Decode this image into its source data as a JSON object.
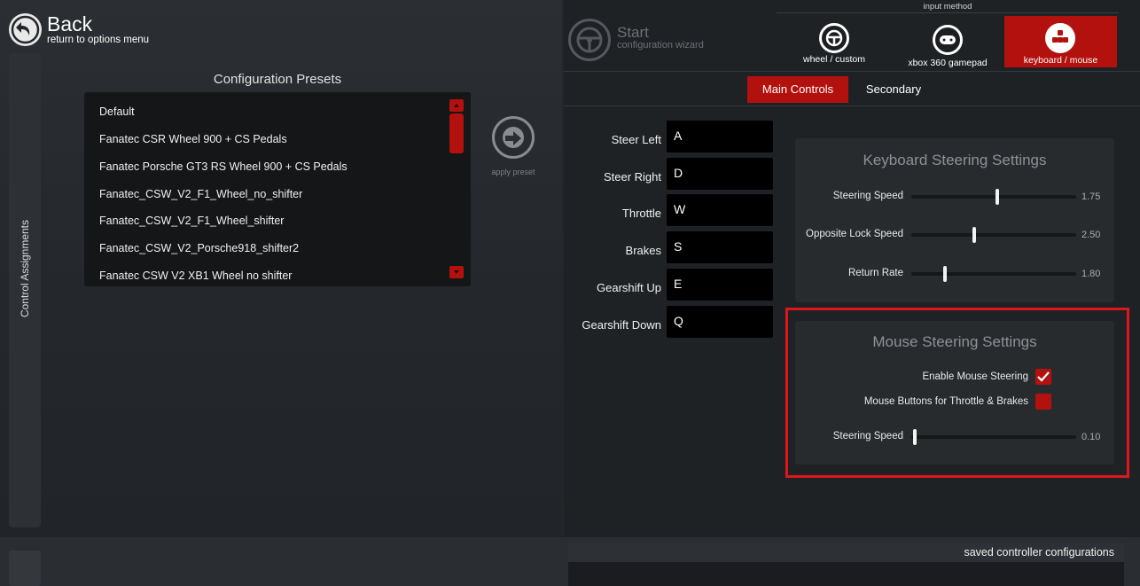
{
  "header": {
    "back_title": "Back",
    "back_subtitle": "return to options menu",
    "back_icon": "arrow-left-circle-icon"
  },
  "sidebar": {
    "label": "Control Assignments"
  },
  "presets": {
    "title": "Configuration Presets",
    "items": [
      "Default",
      "Fanatec CSR Wheel 900 + CS Pedals",
      "Fanatec Porsche GT3 RS Wheel 900 + CS Pedals",
      "Fanatec_CSW_V2_F1_Wheel_no_shifter",
      "Fanatec_CSW_V2_F1_Wheel_shifter",
      "Fanatec_CSW_V2_Porsche918_shifter2",
      "Fanatec CSW V2 XB1 Wheel no shifter"
    ],
    "apply_label": "apply preset",
    "apply_icon": "arrow-right-circle-icon"
  },
  "wizard": {
    "title": "Start",
    "subtitle": "configuration wizard",
    "icon": "steering-wheel-icon"
  },
  "input_method": {
    "label": "input method",
    "options": [
      {
        "label": "wheel / custom",
        "icon": "steering-wheel-icon",
        "active": false
      },
      {
        "label": "xbox 360 gamepad",
        "icon": "gamepad-icon",
        "active": false
      },
      {
        "label": "keyboard / mouse",
        "icon": "keyboard-icon",
        "active": true
      }
    ]
  },
  "tabs": [
    {
      "label": "Main Controls",
      "active": true
    },
    {
      "label": "Secondary",
      "active": false
    }
  ],
  "bindings": [
    {
      "label": "Steer Left",
      "key": "A"
    },
    {
      "label": "Steer Right",
      "key": "D"
    },
    {
      "label": "Throttle",
      "key": "W"
    },
    {
      "label": "Brakes",
      "key": "S"
    },
    {
      "label": "Gearshift Up",
      "key": "E"
    },
    {
      "label": "Gearshift Down",
      "key": "Q"
    }
  ],
  "keyboard_steering": {
    "title": "Keyboard Steering Settings",
    "settings": [
      {
        "label": "Steering Speed",
        "value": "1.75",
        "fraction": 0.52
      },
      {
        "label": "Opposite Lock Speed",
        "value": "2.50",
        "fraction": 0.38
      },
      {
        "label": "Return Rate",
        "value": "1.80",
        "fraction": 0.2
      }
    ]
  },
  "mouse_steering": {
    "title": "Mouse Steering Settings",
    "enable_label": "Enable Mouse Steering",
    "enable_checked": true,
    "buttons_label": "Mouse Buttons for Throttle & Brakes",
    "buttons_checked": false,
    "speed_label": "Steering Speed",
    "speed_value": "0.10",
    "speed_fraction": 0.01
  },
  "footer": {
    "saved_label": "saved controller configurations"
  },
  "colors": {
    "accent": "#b3110e",
    "highlight": "#e0161c"
  }
}
